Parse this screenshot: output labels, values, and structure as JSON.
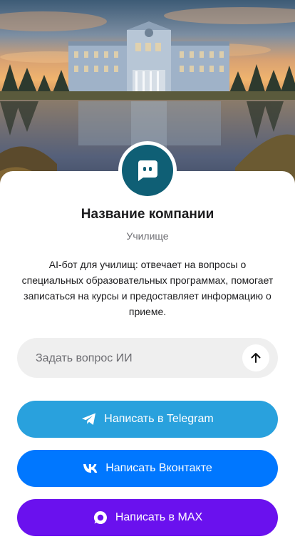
{
  "company": {
    "name": "Название компании",
    "category": "Училище",
    "description": "AI-бот для училищ: отвечает на вопросы о специальных образовательных программах, помогает записаться на курсы и предоставляет информацию о приеме."
  },
  "ask": {
    "placeholder": "Задать вопрос ИИ",
    "send_icon": "arrow-up-icon"
  },
  "buttons": {
    "telegram": {
      "label": "Написать в Telegram",
      "icon": "telegram-icon",
      "color": "#29a1dd"
    },
    "vk": {
      "label": "Написать Вконтакте",
      "icon": "vk-icon",
      "color": "#0077ff"
    },
    "max": {
      "label": "Написать в MAX",
      "icon": "max-icon",
      "color": "#6a11ee"
    }
  },
  "colors": {
    "avatar_bg": "#0f5f75"
  }
}
